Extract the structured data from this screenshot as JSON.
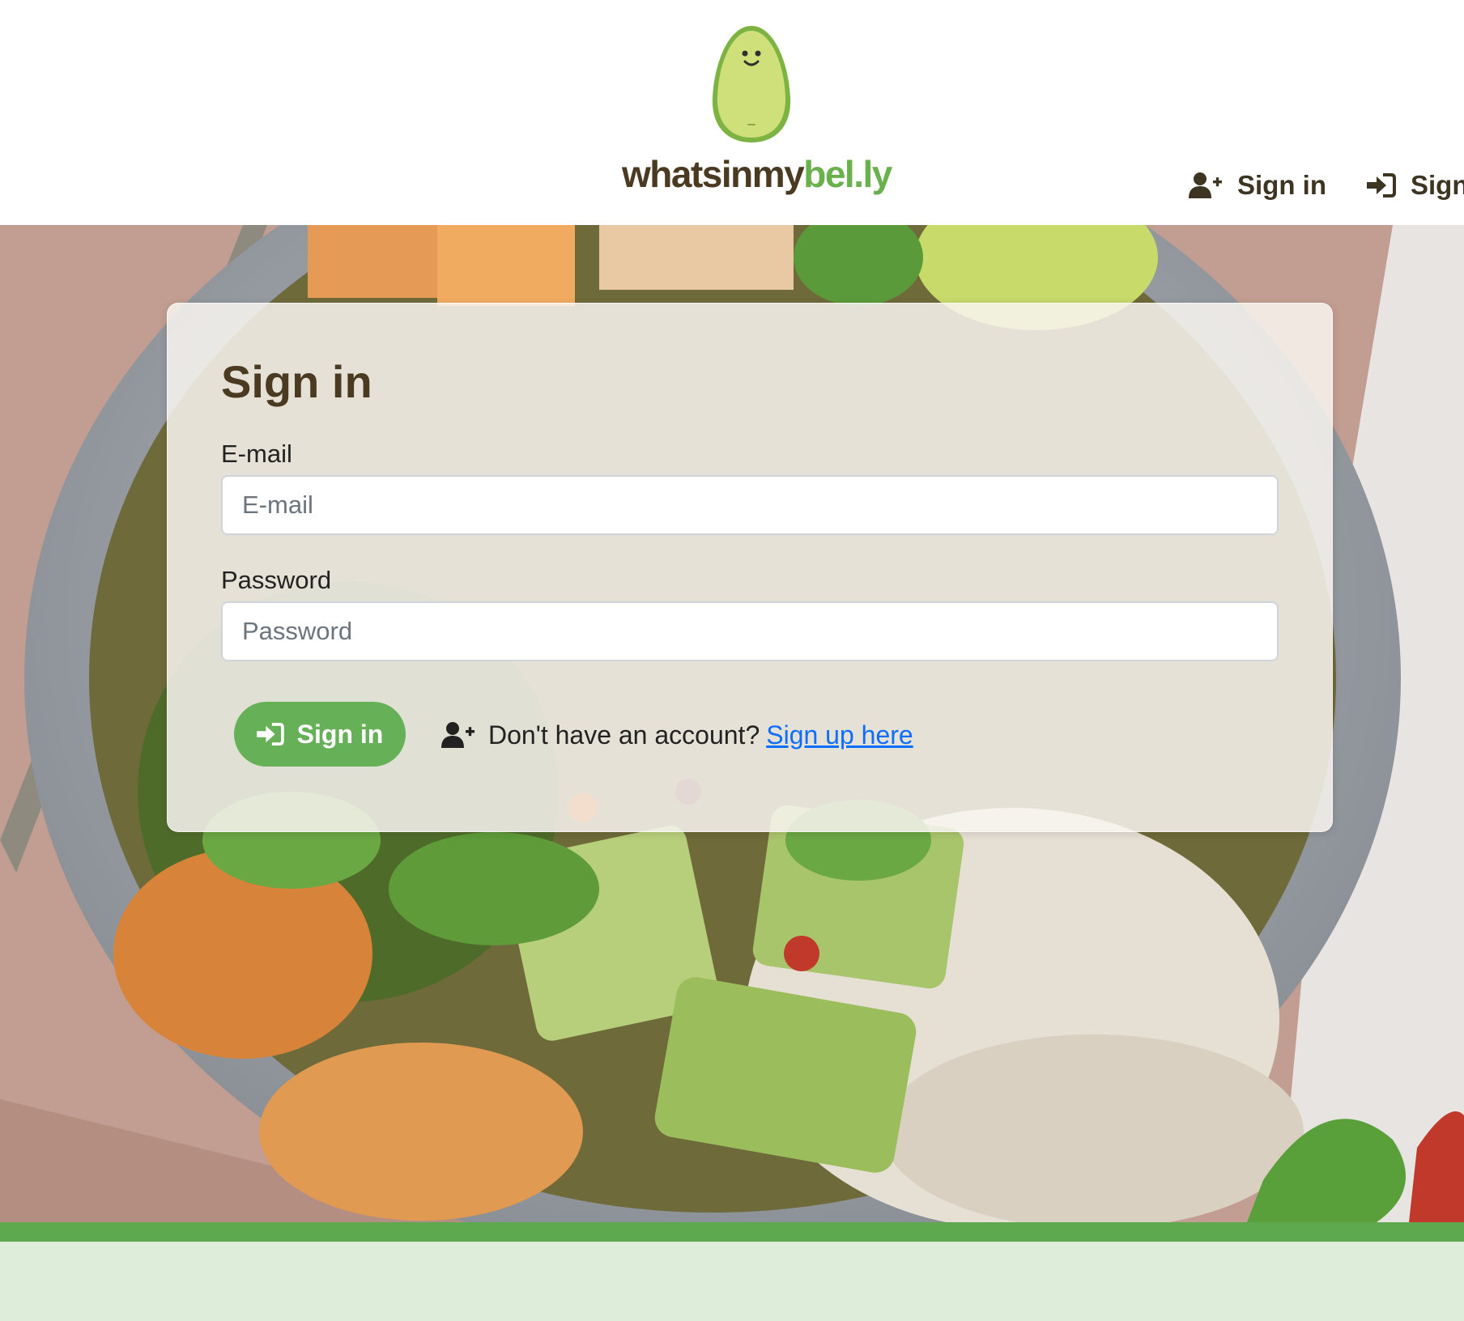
{
  "header": {
    "brand": {
      "name_part1": "whatsinmy",
      "name_part2": "bel.ly",
      "logo_icon": "avocado-mascot-icon"
    },
    "nav": [
      {
        "label": "Sign in",
        "icon": "user-plus-icon"
      },
      {
        "label": "Sign",
        "icon": "sign-in-icon"
      }
    ]
  },
  "form": {
    "title": "Sign in",
    "email": {
      "label": "E-mail",
      "placeholder": "E-mail",
      "value": ""
    },
    "password": {
      "label": "Password",
      "placeholder": "Password",
      "value": ""
    },
    "submit_label": "Sign in",
    "submit_icon": "sign-in-icon",
    "signup_prompt": "Don't have an account?",
    "signup_link": "Sign up here",
    "signup_icon": "user-plus-icon"
  },
  "colors": {
    "brand_dark": "#4a3a22",
    "brand_green": "#6ab04c",
    "button_green": "#66b057",
    "link_blue": "#0d6efd",
    "footer_bar": "#5ea84d",
    "footer_bg": "#deecda"
  }
}
